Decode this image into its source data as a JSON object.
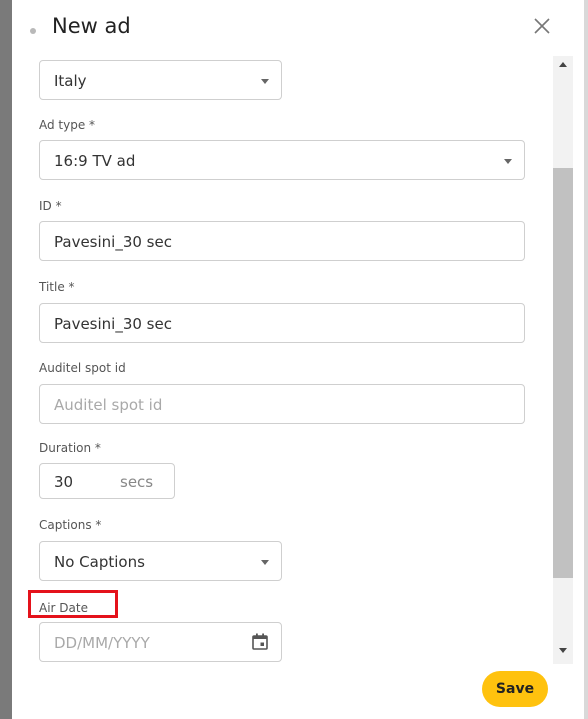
{
  "dialog": {
    "title": "New ad"
  },
  "country": {
    "value": "Italy"
  },
  "ad_type": {
    "label": "Ad type *",
    "value": "16:9 TV ad"
  },
  "id": {
    "label": "ID *",
    "value": "Pavesini_30 sec"
  },
  "title_field": {
    "label": "Title *",
    "value": "Pavesini_30 sec"
  },
  "auditel": {
    "label": "Auditel spot id",
    "placeholder": "Auditel spot id"
  },
  "duration": {
    "label": "Duration *",
    "value": "30",
    "unit": "secs"
  },
  "captions": {
    "label": "Captions *",
    "value": "No Captions"
  },
  "air_date": {
    "label": "Air Date",
    "placeholder": "DD/MM/YYYY"
  },
  "actions": {
    "save_label": "Save"
  },
  "colors": {
    "accent": "#ffc20e",
    "highlight": "#e4121b"
  },
  "icons": {
    "close": "close-icon",
    "calendar": "calendar-icon",
    "dropdown": "chevron-down-icon"
  }
}
